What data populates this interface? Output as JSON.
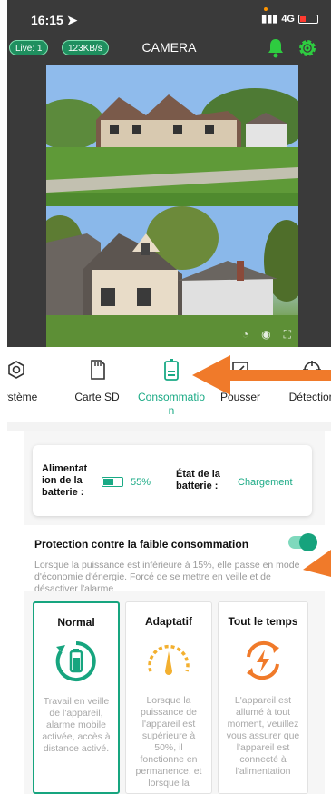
{
  "status_bar": {
    "time": "16:15",
    "network": "4G"
  },
  "top_bar": {
    "live_label": "Live: 1",
    "rate_label": "123KB/s",
    "title": "CAMERA"
  },
  "tabs": [
    {
      "label": "Système",
      "icon": "target-icon"
    },
    {
      "label": "Carte SD",
      "icon": "sd-card-icon"
    },
    {
      "label": "Consommation",
      "icon": "battery-icon",
      "active": true
    },
    {
      "label": "Pousser",
      "icon": "push-icon"
    },
    {
      "label": "Détection",
      "icon": "detection-icon"
    }
  ],
  "battery_info": {
    "power_label": "Alimentation de la batterie :",
    "power_value": "55%",
    "power_level": 0.55,
    "state_label": "État de la batterie :",
    "state_value": "Chargement"
  },
  "protection": {
    "title": "Protection contre la faible consommation",
    "enabled": true,
    "description": "Lorsque la puissance est inférieure à 15%, elle passe en mode d'économie d'énergie. Forcé de se mettre en veille et de désactiver l'alarme"
  },
  "modes": [
    {
      "title": "Normal",
      "description": "Travail en veille de l'appareil, alarme mobile activée, accès à distance activé.",
      "active": true
    },
    {
      "title": "Adaptatif",
      "description": "Lorsque la puissance de l'appareil est supérieure à 50%, il fonctionne en permanence, et lorsque la"
    },
    {
      "title": "Tout le temps",
      "description": "L'appareil est allumé à tout moment, veuillez vous assurer que l'appareil est connecté à l'alimentation"
    }
  ],
  "colors": {
    "accent": "#1aaa85",
    "arrow": "#f07a2a",
    "header_bg": "#3a3a3a"
  }
}
